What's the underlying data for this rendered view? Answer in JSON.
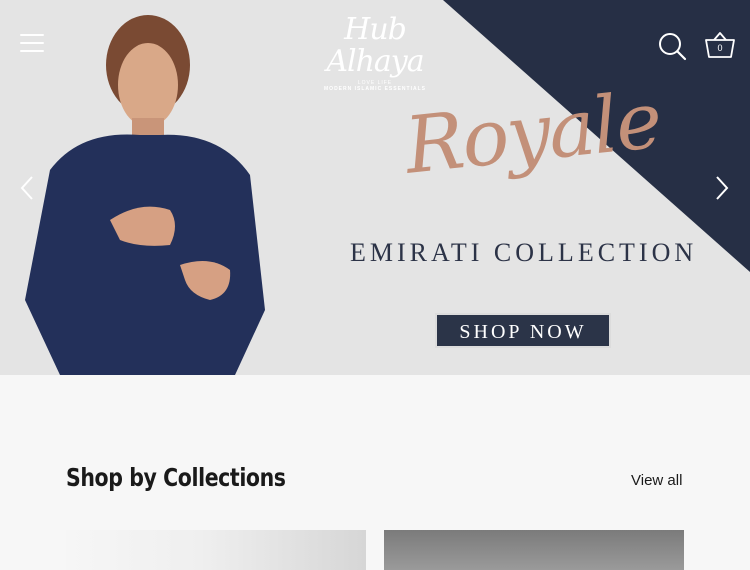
{
  "header": {
    "logo_title": "Hub Alhaya",
    "logo_tagline1": "LOVE LIFE",
    "logo_tagline2": "MODERN ISLAMIC ESSENTIALS",
    "cart_count": "0",
    "icons": {
      "menu": "hamburger-menu-icon",
      "search": "search-icon",
      "cart": "basket-icon"
    }
  },
  "hero": {
    "script_title": "Royale",
    "title": "EMIRATI COLLECTION",
    "cta_label": "SHOP NOW",
    "colors": {
      "navy": "#262f45",
      "background": "#e4e4e4",
      "script": "#c39079"
    }
  },
  "collections": {
    "heading": "Shop by Collections",
    "view_all_label": "View all"
  }
}
